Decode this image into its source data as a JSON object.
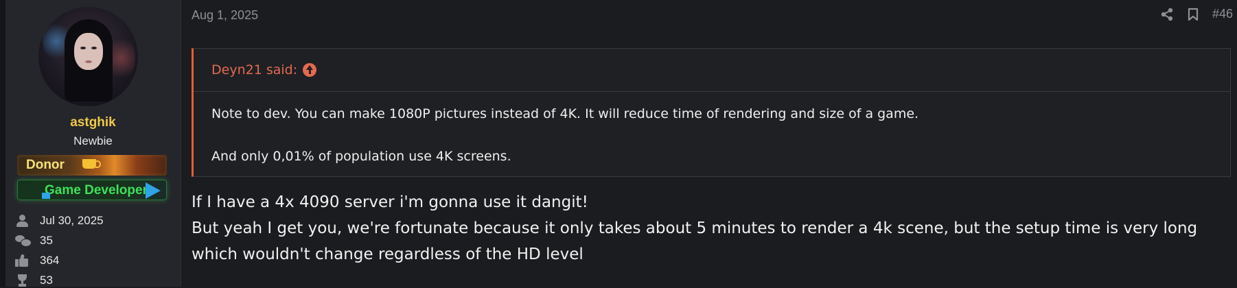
{
  "user": {
    "name": "astghik",
    "title": "Newbie",
    "banners": [
      {
        "label": "Donor"
      },
      {
        "label": "Game Developer"
      }
    ],
    "stats": {
      "joined": "Jul 30, 2025",
      "messages": "35",
      "reactions": "364",
      "points": "53"
    }
  },
  "post": {
    "date": "Aug 1, 2025",
    "number": "#46",
    "quote": {
      "author_line": "Deyn21 said:",
      "paragraphs": [
        "Note to dev. You can make 1080P pictures instead of 4K. It will reduce time of rendering and size of a game.",
        "And only 0,01% of population use 4K screens."
      ]
    },
    "body": [
      "If I have a 4x 4090 server i'm gonna use it dangit!",
      "But yeah I get you, we're fortunate because it only takes about 5 minutes to render a 4k scene, but the setup time is very long which wouldn't change regardless of the HD level"
    ]
  },
  "colors": {
    "username": "#f0c94a",
    "quote_accent": "#e7602e",
    "quote_author": "#e46a50",
    "game_dev_green": "#3ee05a"
  }
}
